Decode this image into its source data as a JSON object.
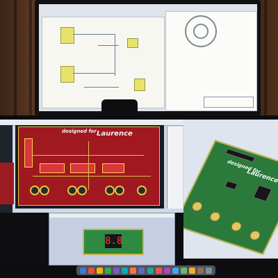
{
  "photo": {
    "description_tags": [
      "top-monitor",
      "webcam",
      "left-pcb-editor",
      "right-3d-viewer",
      "seven-segment-viewer",
      "dock"
    ]
  },
  "pcb_editor": {
    "board_text_1": "designed for",
    "board_text_2": "Laurence"
  },
  "board_3d": {
    "board_text_1": "designed for",
    "board_text_2": "Laurence"
  },
  "seven_segment": {
    "digits": "8.8."
  },
  "dock": {
    "icon_colors": [
      "#3a7bd5",
      "#e94e3c",
      "#f4b400",
      "#34a853",
      "#7e57c2",
      "#00acc1",
      "#ff7043",
      "#5c6bc0",
      "#26a69a",
      "#ef5350",
      "#ab47bc",
      "#42a5f5",
      "#66bb6a",
      "#ffa726",
      "#8d6e63",
      "#78909c"
    ]
  }
}
